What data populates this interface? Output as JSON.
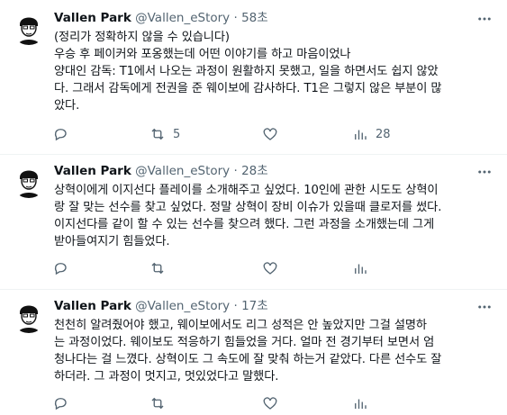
{
  "tweets": [
    {
      "author": "Vallen Park",
      "handle": "@Vallen_eStory",
      "separator": "·",
      "time": "58초",
      "lines": [
        "(정리가 정확하지 않을 수 있습니다)",
        "우승 후 페이커와 포옹했는데 어떤 이야기를 하고 마음이었나",
        "양대인 감독: T1에서 나오는 과정이 원활하지 못했고, 일을 하면서도 쉽지 않았",
        "다. 그래서 감독에게 전권을 준 웨이보에 감사하다. T1은 그렇지 않은 부분이 많",
        "았다."
      ],
      "reply_count": "",
      "retweet_count": "5",
      "like_count": "",
      "view_count": "28"
    },
    {
      "author": "Vallen Park",
      "handle": "@Vallen_eStory",
      "separator": "·",
      "time": "28초",
      "lines": [
        "상혁이에게 이지선다 플레이를 소개해주고 싶었다. 10인에 관한 시도도 상혁이",
        "랑 잘 맞는 선수를 찾고 싶었다. 정말 상혁이 장비 이슈가 있을때 클로저를 썼다.",
        "이지선다를 같이 할 수 있는 선수를 찾으려 했다. 그런 과정을 소개했는데 그게",
        "받아들여지기 힘들었다."
      ],
      "reply_count": "",
      "retweet_count": "",
      "like_count": "",
      "view_count": ""
    },
    {
      "author": "Vallen Park",
      "handle": "@Vallen_eStory",
      "separator": "·",
      "time": "17초",
      "lines": [
        "천천히 알려줬어야 했고, 웨이보에서도 리그 성적은 안 높았지만 그걸 설명하",
        "는 과정이었다. 웨이보도 적응하기 힘들었을 거다. 얼마 전 경기부터 보면서 엄",
        "청나다는 걸 느꼈다. 상혁이도 그 속도에 잘 맞춰 하는거 같았다. 다른 선수도 잘",
        "하더라. 그 과정이 멋지고, 멋있었다고 말했다."
      ],
      "reply_count": "",
      "retweet_count": "",
      "like_count": "",
      "view_count": ""
    }
  ],
  "icons": {
    "reply": "reply-icon",
    "retweet": "retweet-icon",
    "like": "heart-icon",
    "views": "views-icon",
    "more": "more-icon",
    "avatar": "avatar"
  },
  "colors": {
    "text": "#0f1419",
    "muted": "#536471",
    "divider": "#eff3f4"
  }
}
